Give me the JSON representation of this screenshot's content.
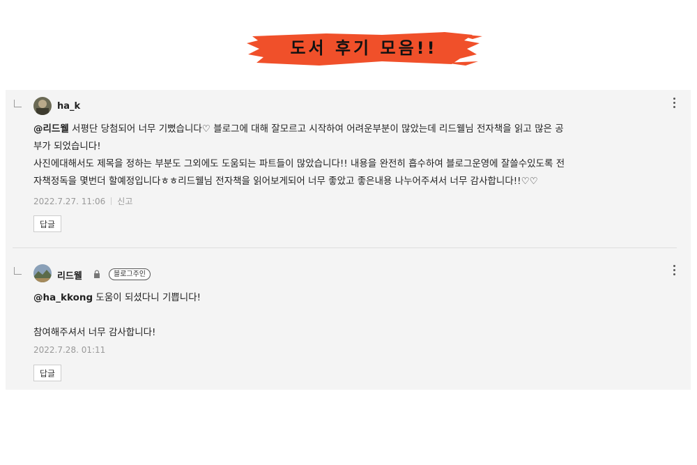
{
  "banner": {
    "title": "도서 후기 모음!!",
    "brush_color": "#f0502a"
  },
  "comments": [
    {
      "author": "ha_k",
      "mention": "@리드웰",
      "text_line1": " 서평단 당첨되어 너무 기뻤습니다♡ 블로그에 대해 잘모르고 시작하여 어려운부분이 많았는데 리드웰님 전자책을 읽고 많은 공",
      "text_line2": "부가 되었습니다!",
      "text_line3": "사진에대해서도 제목을 정하는 부분도 그외에도 도움되는 파트들이 많았습니다!! 내용을 완전히 흡수하여 블로그운영에 잘쓸수있도록 전",
      "text_line4": "자책정독을 몇번더 할예정입니다ㅎㅎ리드웰님 전자책을 읽어보게되어 너무 좋았고 좋은내용 나누어주셔서 너무 감사합니다!!♡♡",
      "date": "2022.7.27. 11:06",
      "report_label": "신고",
      "reply_label": "답글"
    },
    {
      "author": "리드웰",
      "owner_badge": "블로그주인",
      "mention": "@ha_kkong",
      "text_line1": " 도움이 되셨다니 기쁩니다!",
      "text_line2": "참여해주셔서 너무 감사합니다!",
      "date": "2022.7.28. 01:11",
      "reply_label": "답글"
    }
  ]
}
